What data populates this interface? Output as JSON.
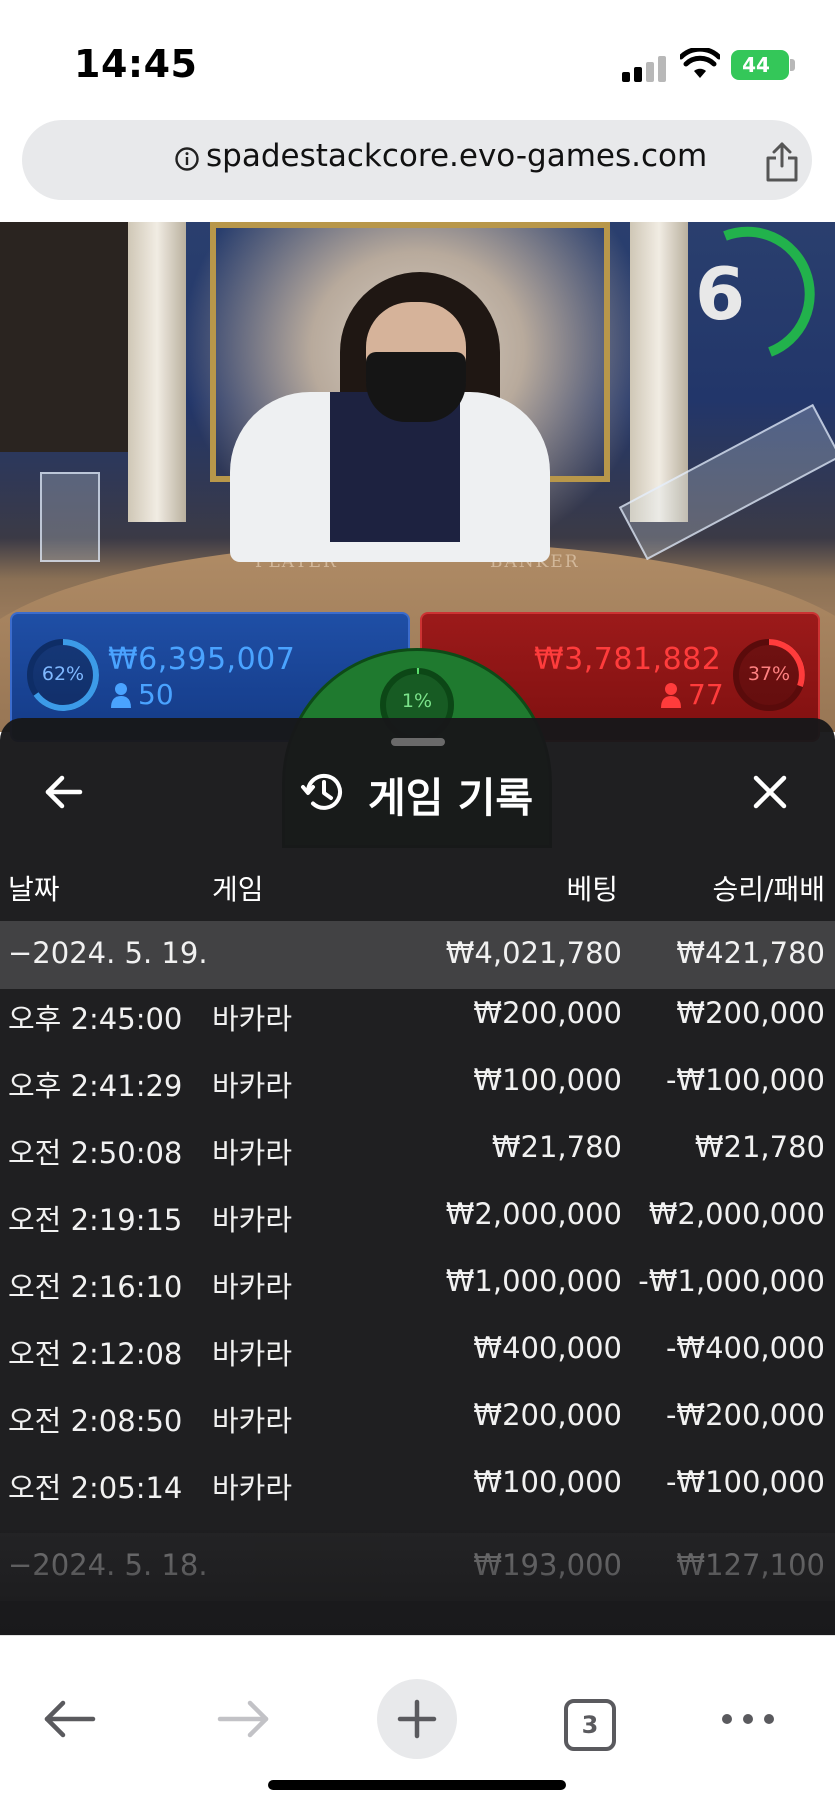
{
  "status_bar": {
    "time": "14:45",
    "battery": "44"
  },
  "browser": {
    "url": "spadestackcore.evo-games.com"
  },
  "game": {
    "timer": "6",
    "table_player_text": "PLAYER",
    "table_banker_text": "BANKER",
    "player": {
      "percent": "62%",
      "amount": "₩6,395,007",
      "count": "50"
    },
    "banker": {
      "percent": "37%",
      "amount": "₩3,781,882",
      "count": "77"
    },
    "tie": {
      "percent": "1%"
    }
  },
  "panel": {
    "title": "게임 기록",
    "columns": {
      "date": "날짜",
      "game": "게임",
      "bet": "베팅",
      "winloss": "승리/패배"
    },
    "day1": {
      "label": "−2024. 5. 19.",
      "bet": "₩4,021,780",
      "winloss": "₩421,780"
    },
    "rows": [
      {
        "time": "오후 2:45:00",
        "game": "바카라",
        "bet": "₩200,000",
        "winloss": "₩200,000"
      },
      {
        "time": "오후 2:41:29",
        "game": "바카라",
        "bet": "₩100,000",
        "winloss": "-₩100,000"
      },
      {
        "time": "오전 2:50:08",
        "game": "바카라",
        "bet": "₩21,780",
        "winloss": "₩21,780"
      },
      {
        "time": "오전 2:19:15",
        "game": "바카라",
        "bet": "₩2,000,000",
        "winloss": "₩2,000,000"
      },
      {
        "time": "오전 2:16:10",
        "game": "바카라",
        "bet": "₩1,000,000",
        "winloss": "-₩1,000,000"
      },
      {
        "time": "오전 2:12:08",
        "game": "바카라",
        "bet": "₩400,000",
        "winloss": "-₩400,000"
      },
      {
        "time": "오전 2:08:50",
        "game": "바카라",
        "bet": "₩200,000",
        "winloss": "-₩200,000"
      },
      {
        "time": "오전 2:05:14",
        "game": "바카라",
        "bet": "₩100,000",
        "winloss": "-₩100,000"
      }
    ],
    "day2": {
      "label": "−2024. 5. 18.",
      "bet": "₩193,000",
      "winloss": "₩127,100"
    }
  },
  "toolbar": {
    "tab_count": "3"
  },
  "colors": {
    "player": "#1f4fa6",
    "banker": "#9c1a1a",
    "tie": "#1f7a2f",
    "timer": "#22b24c",
    "battery": "#34c759"
  }
}
